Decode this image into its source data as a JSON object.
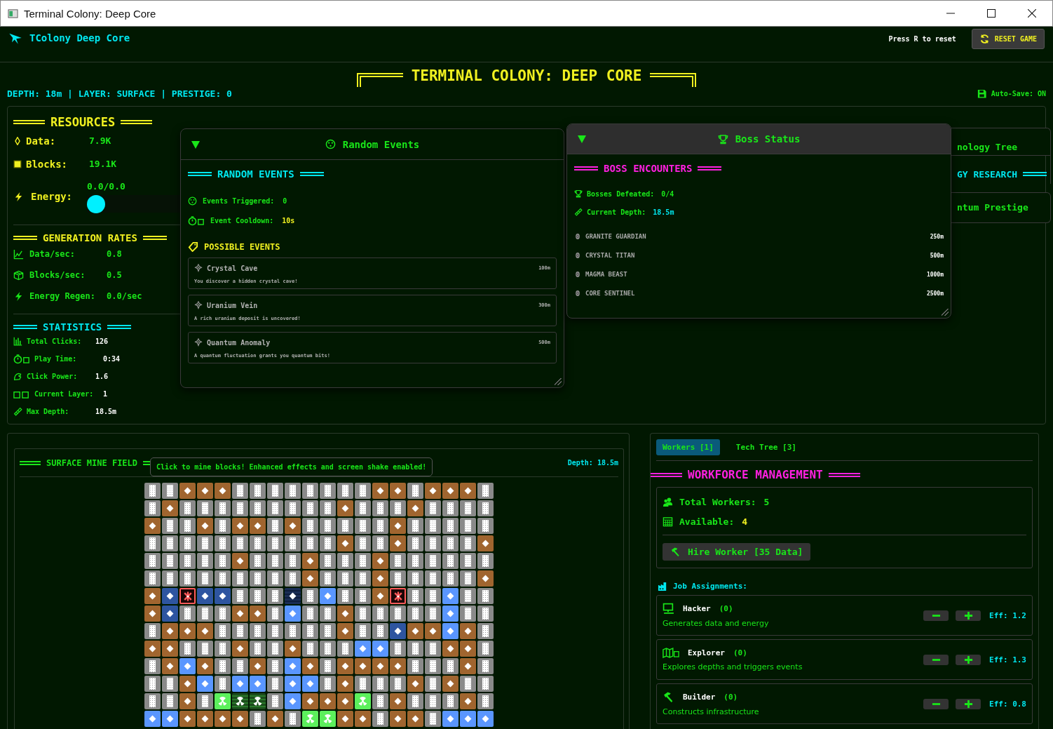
{
  "window": {
    "title": "Terminal Colony: Deep Core"
  },
  "header": {
    "logo": "TColony Deep Core",
    "hint": "Press R to reset",
    "reset_button": "RESET GAME"
  },
  "banner": {
    "title": "TERMINAL COLONY: DEEP CORE",
    "status": "DEPTH: 18m | LAYER: SURFACE | PRESTIGE: 0",
    "autosave": "Auto-Save: ON"
  },
  "resources": {
    "title": "RESOURCES",
    "items": [
      {
        "label": "Data:",
        "value": "7.9K"
      },
      {
        "label": "Blocks:",
        "value": "19.1K"
      }
    ],
    "energy": {
      "label": "Energy:",
      "reading": "0.0/0.0",
      "level": 0
    }
  },
  "generation": {
    "title": "GENERATION RATES",
    "items": [
      {
        "label": "Data/sec:",
        "value": "0.8"
      },
      {
        "label": "Blocks/sec:",
        "value": "0.5"
      },
      {
        "label": "Energy Regen:",
        "value": "0.0/sec"
      }
    ]
  },
  "statistics": {
    "title": "STATISTICS",
    "items": [
      {
        "label": "Total Clicks:",
        "value": "126"
      },
      {
        "label": "Play Time:",
        "value": "0:34"
      },
      {
        "label": "Click Power:",
        "value": "1.6"
      },
      {
        "label": "Current Layer:",
        "value": "1"
      },
      {
        "label": "Max Depth:",
        "value": "18.5m"
      }
    ]
  },
  "random_events": {
    "title": "Random Events",
    "expanded": true,
    "heading": "RANDOM EVENTS",
    "stats": [
      {
        "label": "Events Triggered:",
        "value": "0"
      },
      {
        "label": "Event Cooldown:",
        "value": "10s"
      }
    ],
    "possible_title": "POSSIBLE EVENTS",
    "events": [
      {
        "name": "Crystal Cave",
        "depth": "100m",
        "description": "You discover a hidden crystal cave!"
      },
      {
        "name": "Uranium Vein",
        "depth": "300m",
        "description": "A rich uranium deposit is uncovered!"
      },
      {
        "name": "Quantum Anomaly",
        "depth": "500m",
        "description": "A quantum fluctuation grants you quantum bits!"
      }
    ]
  },
  "boss_status": {
    "title": "Boss Status",
    "expanded": true,
    "heading": "BOSS ENCOUNTERS",
    "stats": [
      {
        "label": "Bosses Defeated:",
        "value": "0/4"
      },
      {
        "label": "Current Depth:",
        "value": "18.5m"
      }
    ],
    "bosses": [
      {
        "name": "GRANITE GUARDIAN",
        "depth": "250m"
      },
      {
        "name": "CRYSTAL TITAN",
        "depth": "500m"
      },
      {
        "name": "MAGMA BEAST",
        "depth": "1000m"
      },
      {
        "name": "CORE SENTINEL",
        "depth": "2500m"
      }
    ]
  },
  "tech_panel": {
    "title": "nology Tree",
    "heading": "GY RESEARCH",
    "prestige": "ntum Prestige"
  },
  "mine": {
    "title": "SURFACE MINE FIELD",
    "tooltip": "Click to mine blocks! Enhanced effects and screen shake enabled!",
    "depth": "Depth: 18.5m",
    "rows": [
      [
        {
          "kind": "stone"
        },
        {
          "kind": "stone"
        },
        {
          "kind": "dirt"
        },
        {
          "kind": "dirt"
        },
        {
          "kind": "dirt"
        },
        {
          "kind": "stone"
        },
        {
          "kind": "stone"
        },
        {
          "kind": "stone"
        },
        {
          "kind": "stone"
        },
        {
          "kind": "stone"
        },
        {
          "kind": "stone"
        },
        {
          "kind": "stone"
        },
        {
          "kind": "stone"
        },
        {
          "kind": "dirt"
        },
        {
          "kind": "dirt"
        },
        {
          "kind": "stone"
        },
        {
          "kind": "dirt"
        },
        {
          "kind": "dirt"
        },
        {
          "kind": "dirt"
        },
        {
          "kind": "stone"
        }
      ],
      [
        {
          "kind": "stone"
        },
        {
          "kind": "dirt"
        },
        {
          "kind": "stone"
        },
        {
          "kind": "stone"
        },
        {
          "kind": "stone"
        },
        {
          "kind": "stone"
        },
        {
          "kind": "stone"
        },
        {
          "kind": "stone"
        },
        {
          "kind": "stone"
        },
        {
          "kind": "stone"
        },
        {
          "kind": "stone"
        },
        {
          "kind": "dirt"
        },
        {
          "kind": "stone"
        },
        {
          "kind": "stone"
        },
        {
          "kind": "stone"
        },
        {
          "kind": "dirt"
        },
        {
          "kind": "stone"
        },
        {
          "kind": "stone"
        },
        {
          "kind": "stone"
        },
        {
          "kind": "stone"
        }
      ],
      [
        {
          "kind": "dirt"
        },
        {
          "kind": "stone"
        },
        {
          "kind": "stone"
        },
        {
          "kind": "dirt"
        },
        {
          "kind": "stone"
        },
        {
          "kind": "dirt"
        },
        {
          "kind": "dirt"
        },
        {
          "kind": "stone"
        },
        {
          "kind": "dirt"
        },
        {
          "kind": "stone"
        },
        {
          "kind": "stone"
        },
        {
          "kind": "stone"
        },
        {
          "kind": "stone"
        },
        {
          "kind": "stone"
        },
        {
          "kind": "dirt"
        },
        {
          "kind": "stone"
        },
        {
          "kind": "stone"
        },
        {
          "kind": "stone"
        },
        {
          "kind": "stone"
        },
        {
          "kind": "stone"
        }
      ],
      [
        {
          "kind": "stone"
        },
        {
          "kind": "stone"
        },
        {
          "kind": "stone"
        },
        {
          "kind": "stone"
        },
        {
          "kind": "stone"
        },
        {
          "kind": "stone"
        },
        {
          "kind": "stone"
        },
        {
          "kind": "stone"
        },
        {
          "kind": "stone"
        },
        {
          "kind": "stone"
        },
        {
          "kind": "stone"
        },
        {
          "kind": "dirt"
        },
        {
          "kind": "stone"
        },
        {
          "kind": "stone"
        },
        {
          "kind": "dirt"
        },
        {
          "kind": "stone"
        },
        {
          "kind": "stone"
        },
        {
          "kind": "stone"
        },
        {
          "kind": "stone"
        },
        {
          "kind": "dirt"
        }
      ],
      [
        {
          "kind": "stone"
        },
        {
          "kind": "stone"
        },
        {
          "kind": "stone"
        },
        {
          "kind": "stone"
        },
        {
          "kind": "stone"
        },
        {
          "kind": "dirt"
        },
        {
          "kind": "stone"
        },
        {
          "kind": "stone"
        },
        {
          "kind": "stone"
        },
        {
          "kind": "dirt"
        },
        {
          "kind": "stone"
        },
        {
          "kind": "stone"
        },
        {
          "kind": "stone"
        },
        {
          "kind": "dirt"
        },
        {
          "kind": "stone"
        },
        {
          "kind": "stone"
        },
        {
          "kind": "stone"
        },
        {
          "kind": "stone"
        },
        {
          "kind": "stone"
        },
        {
          "kind": "stone"
        }
      ],
      [
        {
          "kind": "stone"
        },
        {
          "kind": "stone"
        },
        {
          "kind": "stone"
        },
        {
          "kind": "stone"
        },
        {
          "kind": "stone"
        },
        {
          "kind": "stone"
        },
        {
          "kind": "stone"
        },
        {
          "kind": "stone"
        },
        {
          "kind": "stone"
        },
        {
          "kind": "dirt"
        },
        {
          "kind": "stone"
        },
        {
          "kind": "stone"
        },
        {
          "kind": "stone"
        },
        {
          "kind": "dirt"
        },
        {
          "kind": "stone"
        },
        {
          "kind": "stone"
        },
        {
          "kind": "stone"
        },
        {
          "kind": "stone"
        },
        {
          "kind": "stone"
        },
        {
          "kind": "dirt"
        }
      ],
      [
        {
          "kind": "dirt"
        },
        {
          "kind": "sapphire"
        },
        {
          "kind": "hazard"
        },
        {
          "kind": "sapphire"
        },
        {
          "kind": "sapphire"
        },
        {
          "kind": "stone"
        },
        {
          "kind": "stone"
        },
        {
          "kind": "stone"
        },
        {
          "kind": "obsidian"
        },
        {
          "kind": "stone"
        },
        {
          "kind": "crystal"
        },
        {
          "kind": "stone"
        },
        {
          "kind": "stone"
        },
        {
          "kind": "dirt"
        },
        {
          "kind": "hazard"
        },
        {
          "kind": "stone"
        },
        {
          "kind": "stone"
        },
        {
          "kind": "crystal"
        },
        {
          "kind": "stone"
        },
        {
          "kind": "stone"
        }
      ],
      [
        {
          "kind": "dirt"
        },
        {
          "kind": "sapphire"
        },
        {
          "kind": "stone"
        },
        {
          "kind": "stone"
        },
        {
          "kind": "stone"
        },
        {
          "kind": "dirt"
        },
        {
          "kind": "dirt"
        },
        {
          "kind": "stone"
        },
        {
          "kind": "crystal"
        },
        {
          "kind": "stone"
        },
        {
          "kind": "stone"
        },
        {
          "kind": "dirt"
        },
        {
          "kind": "stone"
        },
        {
          "kind": "stone"
        },
        {
          "kind": "stone"
        },
        {
          "kind": "stone"
        },
        {
          "kind": "stone"
        },
        {
          "kind": "crystal"
        },
        {
          "kind": "stone"
        },
        {
          "kind": "stone"
        }
      ],
      [
        {
          "kind": "stone"
        },
        {
          "kind": "dirt"
        },
        {
          "kind": "dirt"
        },
        {
          "kind": "dirt"
        },
        {
          "kind": "stone"
        },
        {
          "kind": "stone"
        },
        {
          "kind": "stone"
        },
        {
          "kind": "stone"
        },
        {
          "kind": "stone"
        },
        {
          "kind": "stone"
        },
        {
          "kind": "stone"
        },
        {
          "kind": "dirt"
        },
        {
          "kind": "stone"
        },
        {
          "kind": "stone"
        },
        {
          "kind": "sapphire"
        },
        {
          "kind": "dirt"
        },
        {
          "kind": "dirt"
        },
        {
          "kind": "crystal"
        },
        {
          "kind": "dirt"
        },
        {
          "kind": "stone"
        }
      ],
      [
        {
          "kind": "dirt"
        },
        {
          "kind": "dirt"
        },
        {
          "kind": "stone"
        },
        {
          "kind": "stone"
        },
        {
          "kind": "stone"
        },
        {
          "kind": "dirt"
        },
        {
          "kind": "stone"
        },
        {
          "kind": "stone"
        },
        {
          "kind": "dirt"
        },
        {
          "kind": "stone"
        },
        {
          "kind": "stone"
        },
        {
          "kind": "stone"
        },
        {
          "kind": "crystal"
        },
        {
          "kind": "crystal"
        },
        {
          "kind": "stone"
        },
        {
          "kind": "stone"
        },
        {
          "kind": "stone"
        },
        {
          "kind": "dirt"
        },
        {
          "kind": "dirt"
        },
        {
          "kind": "stone"
        }
      ],
      [
        {
          "kind": "stone"
        },
        {
          "kind": "dirt"
        },
        {
          "kind": "crystal"
        },
        {
          "kind": "dirt"
        },
        {
          "kind": "stone"
        },
        {
          "kind": "stone"
        },
        {
          "kind": "dirt"
        },
        {
          "kind": "stone"
        },
        {
          "kind": "crystal"
        },
        {
          "kind": "dirt"
        },
        {
          "kind": "stone"
        },
        {
          "kind": "dirt"
        },
        {
          "kind": "dirt"
        },
        {
          "kind": "dirt"
        },
        {
          "kind": "dirt"
        },
        {
          "kind": "stone"
        },
        {
          "kind": "stone"
        },
        {
          "kind": "stone"
        },
        {
          "kind": "dirt"
        },
        {
          "kind": "stone"
        }
      ],
      [
        {
          "kind": "stone"
        },
        {
          "kind": "stone"
        },
        {
          "kind": "dirt"
        },
        {
          "kind": "crystal"
        },
        {
          "kind": "stone"
        },
        {
          "kind": "crystal"
        },
        {
          "kind": "crystal"
        },
        {
          "kind": "stone"
        },
        {
          "kind": "crystal"
        },
        {
          "kind": "crystal"
        },
        {
          "kind": "stone"
        },
        {
          "kind": "dirt"
        },
        {
          "kind": "stone"
        },
        {
          "kind": "stone"
        },
        {
          "kind": "stone"
        },
        {
          "kind": "dirt"
        },
        {
          "kind": "stone"
        },
        {
          "kind": "dirt"
        },
        {
          "kind": "stone"
        },
        {
          "kind": "stone"
        }
      ],
      [
        {
          "kind": "stone"
        },
        {
          "kind": "stone"
        },
        {
          "kind": "dirt"
        },
        {
          "kind": "stone"
        },
        {
          "kind": "uranium"
        },
        {
          "kind": "depleted"
        },
        {
          "kind": "depleted"
        },
        {
          "kind": "stone"
        },
        {
          "kind": "crystal"
        },
        {
          "kind": "dirt"
        },
        {
          "kind": "dirt"
        },
        {
          "kind": "dirt"
        },
        {
          "kind": "uranium"
        },
        {
          "kind": "stone"
        },
        {
          "kind": "dirt"
        },
        {
          "kind": "stone"
        },
        {
          "kind": "stone"
        },
        {
          "kind": "stone"
        },
        {
          "kind": "dirt"
        },
        {
          "kind": "stone"
        }
      ],
      [
        {
          "kind": "crystal"
        },
        {
          "kind": "crystal"
        },
        {
          "kind": "dirt"
        },
        {
          "kind": "dirt"
        },
        {
          "kind": "dirt"
        },
        {
          "kind": "dirt"
        },
        {
          "kind": "stone"
        },
        {
          "kind": "dirt"
        },
        {
          "kind": "stone"
        },
        {
          "kind": "uranium"
        },
        {
          "kind": "uranium"
        },
        {
          "kind": "dirt"
        },
        {
          "kind": "dirt"
        },
        {
          "kind": "stone"
        },
        {
          "kind": "dirt"
        },
        {
          "kind": "dirt"
        },
        {
          "kind": "stone"
        },
        {
          "kind": "crystal"
        },
        {
          "kind": "crystal"
        },
        {
          "kind": "crystal"
        }
      ]
    ]
  },
  "workers": {
    "tabs": [
      {
        "label": "Workers [1]",
        "selected": true
      },
      {
        "label": "Tech Tree [3]",
        "selected": false
      }
    ],
    "heading": "WORKFORCE MANAGEMENT",
    "total": {
      "label": "Total Workers:",
      "value": "5"
    },
    "available": {
      "label": "Available:",
      "value": "4"
    },
    "hire_button": "Hire Worker [35 Data]",
    "jobs_title": "Job Assignments:",
    "jobs": [
      {
        "name": "Hacker",
        "count": "(0)",
        "description": "Generates data and energy",
        "efficiency": "Eff: 1.2"
      },
      {
        "name": "Explorer",
        "count": "(0)",
        "description": "Explores depths and triggers events",
        "efficiency": "Eff: 1.3"
      },
      {
        "name": "Builder",
        "count": "(0)",
        "description": "Constructs infrastructure",
        "efficiency": "Eff: 0.8"
      }
    ]
  }
}
